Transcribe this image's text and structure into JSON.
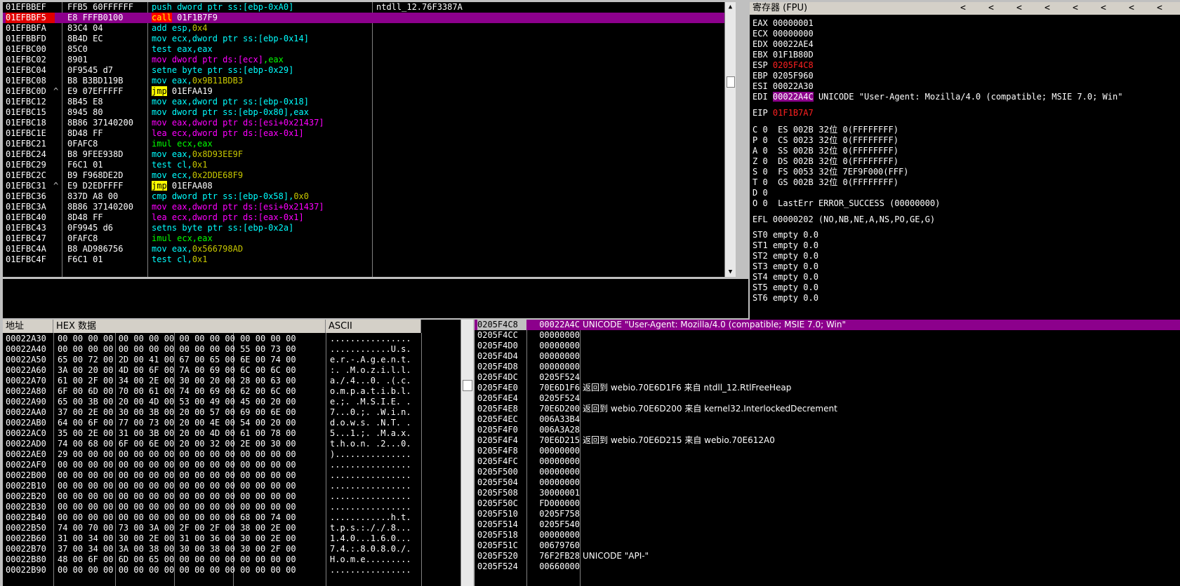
{
  "disasm": [
    {
      "addr": "01EFBBEF",
      "mark": "",
      "hex": "FFB5 60FFFFFF",
      "parts": [
        [
          "m-cyan",
          "push"
        ],
        [
          "m-cyan",
          " dword ptr ss:[ebp-0xA0]"
        ]
      ],
      "comment": "ntdll_12.76F3387A"
    },
    {
      "addr": "01EFBBF5",
      "mark": "",
      "hex": "E8 FFFB0100",
      "parts": [
        [
          "m-call",
          "call"
        ],
        [
          "m-white",
          " 01F1B7F9"
        ]
      ],
      "comment": "",
      "selected": true
    },
    {
      "addr": "01EFBBFA",
      "mark": "",
      "hex": "83C4 04",
      "parts": [
        [
          "m-cyan",
          "add"
        ],
        [
          "m-cyan",
          " esp,"
        ],
        [
          "m-olive",
          "0x4"
        ]
      ],
      "comment": ""
    },
    {
      "addr": "01EFBBFD",
      "mark": "",
      "hex": "8B4D EC",
      "parts": [
        [
          "m-cyan",
          "mov"
        ],
        [
          "m-cyan",
          " ecx,dword ptr ss:[ebp-0x14]"
        ]
      ],
      "comment": ""
    },
    {
      "addr": "01EFBC00",
      "mark": "",
      "hex": "85C0",
      "parts": [
        [
          "m-cyan",
          "test"
        ],
        [
          "m-cyan",
          " eax,eax"
        ]
      ],
      "comment": ""
    },
    {
      "addr": "01EFBC02",
      "mark": "",
      "hex": "8901",
      "parts": [
        [
          "m-mag",
          "mov"
        ],
        [
          "m-mag",
          " dword ptr ds:[ecx]"
        ],
        [
          "m-grn",
          ",eax"
        ]
      ],
      "comment": ""
    },
    {
      "addr": "01EFBC04",
      "mark": "",
      "hex": "0F9545 d7",
      "parts": [
        [
          "m-cyan",
          "setne"
        ],
        [
          "m-cyan",
          " byte ptr ss:[ebp-0x29]"
        ]
      ],
      "comment": ""
    },
    {
      "addr": "01EFBC08",
      "mark": "",
      "hex": "B8 B3BD119B",
      "parts": [
        [
          "m-cyan",
          "mov"
        ],
        [
          "m-cyan",
          " eax,"
        ],
        [
          "m-olive",
          "0x9B11BDB3"
        ]
      ],
      "comment": ""
    },
    {
      "addr": "01EFBC0D",
      "mark": "^",
      "hex": "E9 07EFFFFF",
      "parts": [
        [
          "m-jmp",
          "jmp"
        ],
        [
          "m-white",
          " 01EFAA19"
        ]
      ],
      "comment": ""
    },
    {
      "addr": "01EFBC12",
      "mark": "",
      "hex": "8B45 E8",
      "parts": [
        [
          "m-cyan",
          "mov"
        ],
        [
          "m-cyan",
          " eax,dword ptr ss:[ebp-0x18]"
        ]
      ],
      "comment": ""
    },
    {
      "addr": "01EFBC15",
      "mark": "",
      "hex": "8945 80",
      "parts": [
        [
          "m-cyan",
          "mov"
        ],
        [
          "m-cyan",
          " dword ptr ss:[ebp-0x80],eax"
        ]
      ],
      "comment": ""
    },
    {
      "addr": "01EFBC18",
      "mark": "",
      "hex": "8B86 37140200",
      "parts": [
        [
          "m-mag",
          "mov"
        ],
        [
          "m-mag",
          " eax,dword ptr ds:[esi+0x21437]"
        ]
      ],
      "comment": ""
    },
    {
      "addr": "01EFBC1E",
      "mark": "",
      "hex": "8D48 FF",
      "parts": [
        [
          "m-mag",
          "lea"
        ],
        [
          "m-mag",
          " ecx,dword ptr ds:[eax-0x1]"
        ]
      ],
      "comment": ""
    },
    {
      "addr": "01EFBC21",
      "mark": "",
      "hex": "0FAFC8",
      "parts": [
        [
          "m-grn",
          "imul"
        ],
        [
          "m-grn",
          " ecx,eax"
        ]
      ],
      "comment": ""
    },
    {
      "addr": "01EFBC24",
      "mark": "",
      "hex": "B8 9FEE938D",
      "parts": [
        [
          "m-cyan",
          "mov"
        ],
        [
          "m-cyan",
          " eax,"
        ],
        [
          "m-olive",
          "0x8D93EE9F"
        ]
      ],
      "comment": ""
    },
    {
      "addr": "01EFBC29",
      "mark": "",
      "hex": "F6C1 01",
      "parts": [
        [
          "m-cyan",
          "test"
        ],
        [
          "m-cyan",
          " cl,"
        ],
        [
          "m-olive",
          "0x1"
        ]
      ],
      "comment": ""
    },
    {
      "addr": "01EFBC2C",
      "mark": "",
      "hex": "B9 F968DE2D",
      "parts": [
        [
          "m-cyan",
          "mov"
        ],
        [
          "m-cyan",
          " ecx,"
        ],
        [
          "m-olive",
          "0x2DDE68F9"
        ]
      ],
      "comment": ""
    },
    {
      "addr": "01EFBC31",
      "mark": "^",
      "hex": "E9 D2EDFFFF",
      "parts": [
        [
          "m-jmp",
          "jmp"
        ],
        [
          "m-white",
          " 01EFAA08"
        ]
      ],
      "comment": ""
    },
    {
      "addr": "01EFBC36",
      "mark": "",
      "hex": "837D A8 00",
      "parts": [
        [
          "m-cyan",
          "cmp"
        ],
        [
          "m-cyan",
          " dword ptr ss:[ebp-0x58],"
        ],
        [
          "m-olive",
          "0x0"
        ]
      ],
      "comment": ""
    },
    {
      "addr": "01EFBC3A",
      "mark": "",
      "hex": "8B86 37140200",
      "parts": [
        [
          "m-mag",
          "mov"
        ],
        [
          "m-mag",
          " eax,dword ptr ds:[esi+0x21437]"
        ]
      ],
      "comment": ""
    },
    {
      "addr": "01EFBC40",
      "mark": "",
      "hex": "8D48 FF",
      "parts": [
        [
          "m-mag",
          "lea"
        ],
        [
          "m-mag",
          " ecx,dword ptr ds:[eax-0x1]"
        ]
      ],
      "comment": ""
    },
    {
      "addr": "01EFBC43",
      "mark": "",
      "hex": "0F9945 d6",
      "parts": [
        [
          "m-cyan",
          "setns"
        ],
        [
          "m-cyan",
          " byte ptr ss:[ebp-0x2a]"
        ]
      ],
      "comment": ""
    },
    {
      "addr": "01EFBC47",
      "mark": "",
      "hex": "0FAFC8",
      "parts": [
        [
          "m-grn",
          "imul"
        ],
        [
          "m-grn",
          " ecx,eax"
        ]
      ],
      "comment": ""
    },
    {
      "addr": "01EFBC4A",
      "mark": "",
      "hex": "B8 AD986756",
      "parts": [
        [
          "m-cyan",
          "mov"
        ],
        [
          "m-cyan",
          " eax,"
        ],
        [
          "m-olive",
          "0x566798AD"
        ]
      ],
      "comment": ""
    },
    {
      "addr": "01EFBC4F",
      "mark": "",
      "hex": "F6C1 01",
      "parts": [
        [
          "m-cyan",
          "test"
        ],
        [
          "m-cyan",
          " cl,"
        ],
        [
          "m-olive",
          "0x1"
        ]
      ],
      "comment": ""
    }
  ],
  "registers": {
    "title": "寄存器 (FPU)",
    "gp": [
      {
        "name": "EAX",
        "value": "00000001"
      },
      {
        "name": "ECX",
        "value": "00000000"
      },
      {
        "name": "EDX",
        "value": "00022AE4"
      },
      {
        "name": "EBX",
        "value": "01F1B80D"
      },
      {
        "name": "ESP",
        "value": "0205F4C8",
        "changed": true
      },
      {
        "name": "EBP",
        "value": "0205F960"
      },
      {
        "name": "ESI",
        "value": "00022A30"
      },
      {
        "name": "EDI",
        "value": "00022A4C",
        "note": "UNICODE \"User-Agent: Mozilla/4.0 (compatible; MSIE 7.0; Win\"",
        "highlight": true
      }
    ],
    "eip": {
      "name": "EIP",
      "value": "01F1B7A7"
    },
    "flags": [
      {
        "flag": "C 0",
        "seg": "ES 002B",
        "bits": "32位",
        "base": "0(FFFFFFFF)"
      },
      {
        "flag": "P 0",
        "seg": "CS 0023",
        "bits": "32位",
        "base": "0(FFFFFFFF)"
      },
      {
        "flag": "A 0",
        "seg": "SS 002B",
        "bits": "32位",
        "base": "0(FFFFFFFF)"
      },
      {
        "flag": "Z 0",
        "seg": "DS 002B",
        "bits": "32位",
        "base": "0(FFFFFFFF)"
      },
      {
        "flag": "S 0",
        "seg": "FS 0053",
        "bits": "32位",
        "base": "7EF9F000(FFF)"
      },
      {
        "flag": "T 0",
        "seg": "GS 002B",
        "bits": "32位",
        "base": "0(FFFFFFFF)"
      },
      {
        "flag": "D 0",
        "seg": "",
        "bits": "",
        "base": ""
      },
      {
        "flag": "O 0",
        "seg": "LastErr ERROR_SUCCESS (00000000)",
        "bits": "",
        "base": ""
      }
    ],
    "efl": "EFL 00000202 (NO,NB,NE,A,NS,PO,GE,G)",
    "fpu": [
      "ST0 empty 0.0",
      "ST1 empty 0.0",
      "ST2 empty 0.0",
      "ST3 empty 0.0",
      "ST4 empty 0.0",
      "ST5 empty 0.0",
      "ST6 empty 0.0"
    ]
  },
  "dump": {
    "headers": {
      "addr": "地址",
      "hex": "HEX 数据",
      "ascii": "ASCII"
    },
    "rows": [
      {
        "addr": "00022A30",
        "hex": "00 00 00 00 00 00 00 00 00 00 00 00 00 00 00 00",
        "ascii": "................"
      },
      {
        "addr": "00022A40",
        "hex": "00 00 00 00 00 00 00 00 00 00 00 00 55 00 73 00",
        "ascii": "............U.s."
      },
      {
        "addr": "00022A50",
        "hex": "65 00 72 00 2D 00 41 00 67 00 65 00 6E 00 74 00",
        "ascii": "e.r.-.A.g.e.n.t."
      },
      {
        "addr": "00022A60",
        "hex": "3A 00 20 00 4D 00 6F 00 7A 00 69 00 6C 00 6C 00",
        "ascii": ":. .M.o.z.i.l.l."
      },
      {
        "addr": "00022A70",
        "hex": "61 00 2F 00 34 00 2E 00 30 00 20 00 28 00 63 00",
        "ascii": "a./.4...0. .(.c."
      },
      {
        "addr": "00022A80",
        "hex": "6F 00 6D 00 70 00 61 00 74 00 69 00 62 00 6C 00",
        "ascii": "o.m.p.a.t.i.b.l."
      },
      {
        "addr": "00022A90",
        "hex": "65 00 3B 00 20 00 4D 00 53 00 49 00 45 00 20 00",
        "ascii": "e.;. .M.S.I.E. ."
      },
      {
        "addr": "00022AA0",
        "hex": "37 00 2E 00 30 00 3B 00 20 00 57 00 69 00 6E 00",
        "ascii": "7...0.;. .W.i.n."
      },
      {
        "addr": "00022AB0",
        "hex": "64 00 6F 00 77 00 73 00 20 00 4E 00 54 00 20 00",
        "ascii": "d.o.w.s. .N.T. ."
      },
      {
        "addr": "00022AC0",
        "hex": "35 00 2E 00 31 00 3B 00 20 00 4D 00 61 00 78 00",
        "ascii": "5...1.;. .M.a.x."
      },
      {
        "addr": "00022AD0",
        "hex": "74 00 68 00 6F 00 6E 00 20 00 32 00 2E 00 30 00",
        "ascii": "t.h.o.n. .2...0."
      },
      {
        "addr": "00022AE0",
        "hex": "29 00 00 00 00 00 00 00 00 00 00 00 00 00 00 00",
        "ascii": ")..............."
      },
      {
        "addr": "00022AF0",
        "hex": "00 00 00 00 00 00 00 00 00 00 00 00 00 00 00 00",
        "ascii": "................"
      },
      {
        "addr": "00022B00",
        "hex": "00 00 00 00 00 00 00 00 00 00 00 00 00 00 00 00",
        "ascii": "................"
      },
      {
        "addr": "00022B10",
        "hex": "00 00 00 00 00 00 00 00 00 00 00 00 00 00 00 00",
        "ascii": "................"
      },
      {
        "addr": "00022B20",
        "hex": "00 00 00 00 00 00 00 00 00 00 00 00 00 00 00 00",
        "ascii": "................"
      },
      {
        "addr": "00022B30",
        "hex": "00 00 00 00 00 00 00 00 00 00 00 00 00 00 00 00",
        "ascii": "................"
      },
      {
        "addr": "00022B40",
        "hex": "00 00 00 00 00 00 00 00 00 00 00 00 68 00 74 00",
        "ascii": "............h.t."
      },
      {
        "addr": "00022B50",
        "hex": "74 00 70 00 73 00 3A 00 2F 00 2F 00 38 00 2E 00",
        "ascii": "t.p.s.:././.8..."
      },
      {
        "addr": "00022B60",
        "hex": "31 00 34 00 30 00 2E 00 31 00 36 00 30 00 2E 00",
        "ascii": "1.4.0...1.6.0..."
      },
      {
        "addr": "00022B70",
        "hex": "37 00 34 00 3A 00 38 00 30 00 38 00 30 00 2F 00",
        "ascii": "7.4.:.8.0.8.0./."
      },
      {
        "addr": "00022B80",
        "hex": "48 00 6F 00 6D 00 65 00 00 00 00 00 00 00 00 00",
        "ascii": "H.o.m.e........."
      },
      {
        "addr": "00022B90",
        "hex": "00 00 00 00 00 00 00 00 00 00 00 00 00 00 00 00",
        "ascii": "................"
      }
    ]
  },
  "stack": [
    {
      "addr": "0205F4C8",
      "value": "00022A4C",
      "comment": "UNICODE \"User-Agent: Mozilla/4.0 (compatible; MSIE 7.0; Win\"",
      "selected": true
    },
    {
      "addr": "0205F4CC",
      "value": "00000000",
      "comment": ""
    },
    {
      "addr": "0205F4D0",
      "value": "00000000",
      "comment": ""
    },
    {
      "addr": "0205F4D4",
      "value": "00000000",
      "comment": ""
    },
    {
      "addr": "0205F4D8",
      "value": "00000000",
      "comment": ""
    },
    {
      "addr": "0205F4DC",
      "value": "0205F524",
      "comment": ""
    },
    {
      "addr": "0205F4E0",
      "value": "70E6D1F6",
      "comment": "返回到 webio.70E6D1F6 来自 ntdll_12.RtlFreeHeap"
    },
    {
      "addr": "0205F4E4",
      "value": "0205F524",
      "comment": ""
    },
    {
      "addr": "0205F4E8",
      "value": "70E6D200",
      "comment": "返回到 webio.70E6D200 来自 kernel32.InterlockedDecrement"
    },
    {
      "addr": "0205F4EC",
      "value": "006A33B4",
      "comment": ""
    },
    {
      "addr": "0205F4F0",
      "value": "006A3A28",
      "comment": ""
    },
    {
      "addr": "0205F4F4",
      "value": "70E6D215",
      "comment": "返回到 webio.70E6D215 来自 webio.70E612A0"
    },
    {
      "addr": "0205F4F8",
      "value": "00000000",
      "comment": ""
    },
    {
      "addr": "0205F4FC",
      "value": "00000000",
      "comment": ""
    },
    {
      "addr": "0205F500",
      "value": "00000000",
      "comment": ""
    },
    {
      "addr": "0205F504",
      "value": "00000000",
      "comment": ""
    },
    {
      "addr": "0205F508",
      "value": "30000001",
      "comment": ""
    },
    {
      "addr": "0205F50C",
      "value": "FD000000",
      "comment": ""
    },
    {
      "addr": "0205F510",
      "value": "0205F758",
      "comment": ""
    },
    {
      "addr": "0205F514",
      "value": "0205F540",
      "comment": ""
    },
    {
      "addr": "0205F518",
      "value": "00000000",
      "comment": ""
    },
    {
      "addr": "0205F51C",
      "value": "00679760",
      "comment": ""
    },
    {
      "addr": "0205F520",
      "value": "76F2FB28",
      "comment": "UNICODE \"API-\""
    },
    {
      "addr": "0205F524",
      "value": "00660000",
      "comment": ""
    }
  ]
}
